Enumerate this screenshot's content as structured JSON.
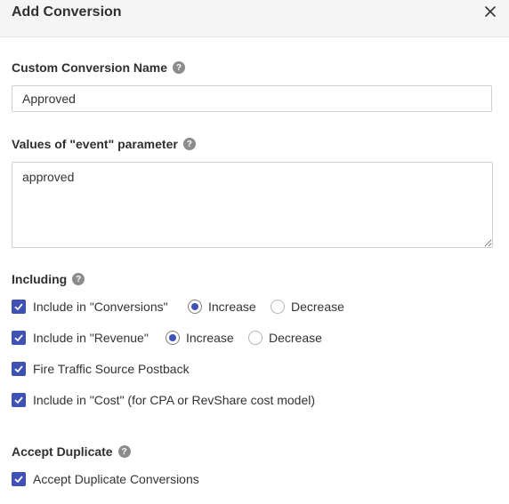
{
  "dialog": {
    "title": "Add Conversion"
  },
  "name_field": {
    "label": "Custom Conversion Name",
    "value": "Approved"
  },
  "event_field": {
    "label": "Values of \"event\" parameter",
    "value": "approved"
  },
  "including": {
    "label": "Including",
    "conversions": {
      "label": "Include in \"Conversions\"",
      "checked": true,
      "increase_label": "Increase",
      "decrease_label": "Decrease",
      "selected": "Increase"
    },
    "revenue": {
      "label": "Include in \"Revenue\"",
      "checked": true,
      "increase_label": "Increase",
      "decrease_label": "Decrease",
      "selected": "Increase"
    },
    "postback": {
      "label": "Fire Traffic Source Postback",
      "checked": true
    },
    "cost": {
      "label": "Include in \"Cost\" (for CPA or RevShare cost model)",
      "checked": true
    }
  },
  "duplicate": {
    "label": "Accept Duplicate",
    "option": {
      "label": "Accept Duplicate Conversions",
      "checked": true
    }
  },
  "icons": {
    "close": "close-icon",
    "help": "help-icon",
    "check": "check-icon"
  },
  "colors": {
    "accent": "#3f51b5",
    "header_bg": "#f5f5f5",
    "help_bg": "#8c8c8c"
  }
}
